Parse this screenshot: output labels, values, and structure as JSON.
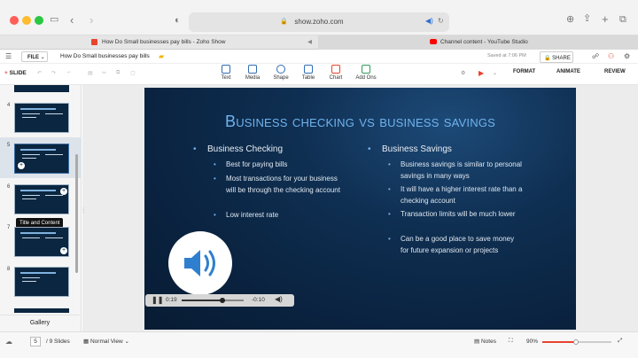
{
  "browser": {
    "url": "show.zoho.com",
    "tabs": [
      {
        "label": "How Do Small businesses pay bills - Zoho Show"
      },
      {
        "label": "Channel content - YouTube Studio"
      }
    ]
  },
  "zoho": {
    "file_label": "FILE",
    "doc_title": "How Do Small businesses pay bills",
    "saved_text": "Saved at 7:06 PM",
    "share_label": "SHARE",
    "add_slide_label": "SLIDE",
    "ribbon": [
      {
        "label": "Text",
        "icon": "text-icon"
      },
      {
        "label": "Media",
        "icon": "media-icon"
      },
      {
        "label": "Shape",
        "icon": "shape-icon"
      },
      {
        "label": "Table",
        "icon": "table-icon"
      },
      {
        "label": "Chart",
        "icon": "chart-icon"
      },
      {
        "label": "Add Ons",
        "icon": "addons-icon"
      }
    ],
    "right_tabs": [
      "FORMAT",
      "ANIMATE",
      "REVIEW"
    ]
  },
  "sidebar": {
    "slide_numbers": [
      "4",
      "5",
      "6",
      "7",
      "8"
    ],
    "tooltip": "Title and Content",
    "gallery_label": "Gallery"
  },
  "slide": {
    "title": "Business checking vs business savings",
    "left": {
      "heading": "Business Checking",
      "bullets": [
        "Best for paying bills",
        "Most transactions for your business will be through the checking account",
        "Low interest rate"
      ]
    },
    "right": {
      "heading": "Business Savings",
      "bullets": [
        "Business savings is similar to personal savings in many ways",
        "It will have a higher interest rate than a checking account",
        "Transaction limits will be much lower",
        "Can be a good place to save money for future expansion or projects"
      ]
    }
  },
  "audio": {
    "elapsed": "0:19",
    "remaining": "-0:10",
    "progress": 0.66
  },
  "status": {
    "current_slide": "5",
    "total_slides": "/ 9 Slides",
    "view_mode": "Normal View",
    "notes_label": "Notes",
    "zoom": "90%"
  },
  "colors": {
    "accent": "#e8442e",
    "title_blue": "#6fb3ee",
    "slide_bg": "#0a2340"
  }
}
